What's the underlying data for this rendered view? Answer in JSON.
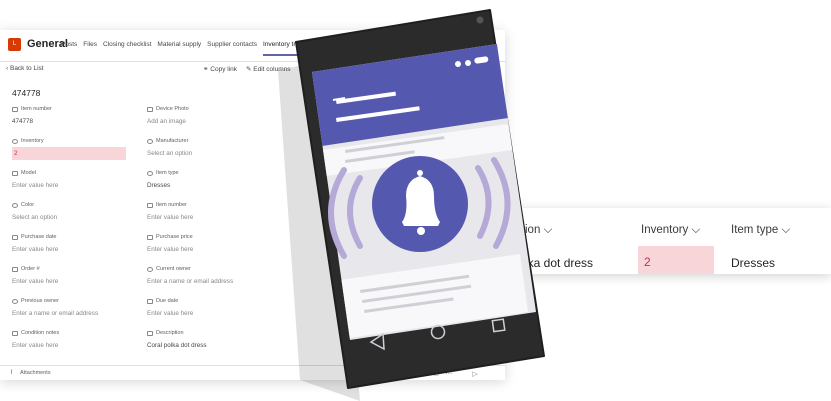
{
  "list_view": {
    "columns": [
      {
        "label": "ion",
        "chevron": "chevron-down-icon"
      },
      {
        "label": "Inventory",
        "chevron": "chevron-down-icon"
      },
      {
        "label": "Item type",
        "chevron": "chevron-down-icon"
      }
    ],
    "row": {
      "description": "lka dot dress",
      "inventory": "2",
      "item_type": "Dresses"
    }
  },
  "teams": {
    "app_icon_text": "L",
    "channel": "General",
    "tabs": [
      "Posts",
      "Files",
      "Closing checklist",
      "Material supply",
      "Supplier contacts",
      "Inventory tracke"
    ],
    "active_tab": "Inventory tracke",
    "back_label": "Back to List",
    "copy_link_label": "Copy link",
    "edit_columns_label": "Edit columns",
    "item_title": "474778",
    "fields_left": [
      {
        "label": "Item number",
        "value": "474778",
        "state": "filled"
      },
      {
        "label": "Inventory",
        "value": "2",
        "state": "error"
      },
      {
        "label": "Model",
        "value": "Enter value here",
        "state": "placeholder"
      },
      {
        "label": "Color",
        "value": "Select an option",
        "state": "placeholder"
      },
      {
        "label": "Purchase date",
        "value": "Enter value here",
        "state": "placeholder"
      },
      {
        "label": "Order #",
        "value": "Enter value here",
        "state": "placeholder"
      },
      {
        "label": "Previous owner",
        "value": "Enter a name or email address",
        "state": "placeholder"
      },
      {
        "label": "Condition notes",
        "value": "Enter value here",
        "state": "placeholder"
      }
    ],
    "fields_right": [
      {
        "label": "Device Photo",
        "value": "Add an image",
        "state": "placeholder"
      },
      {
        "label": "Manufacturer",
        "value": "Select an option",
        "state": "placeholder"
      },
      {
        "label": "Item type",
        "value": "Dresses",
        "state": "filled"
      },
      {
        "label": "Item number",
        "value": "Enter value here",
        "state": "placeholder"
      },
      {
        "label": "Purchase price",
        "value": "Enter value here",
        "state": "placeholder"
      },
      {
        "label": "Current owner",
        "value": "Enter a name or email address",
        "state": "placeholder"
      },
      {
        "label": "Due date",
        "value": "Enter value here",
        "state": "placeholder"
      },
      {
        "label": "Description",
        "value": "Coral polka dot dress",
        "state": "filled"
      }
    ],
    "attachments_label": "Attachments"
  },
  "phone": {
    "notification_icon": "bell-icon",
    "nav_buttons": [
      "back-triangle-icon",
      "home-circle-icon",
      "recents-square-icon"
    ]
  },
  "colors": {
    "teams_purple": "#5558af",
    "phone_body": "#2b2b2b",
    "wave_lavender": "#b5a9d8",
    "error_pink": "#f7d5d9",
    "error_text": "#c4314b",
    "office_orange": "#d83b01"
  }
}
